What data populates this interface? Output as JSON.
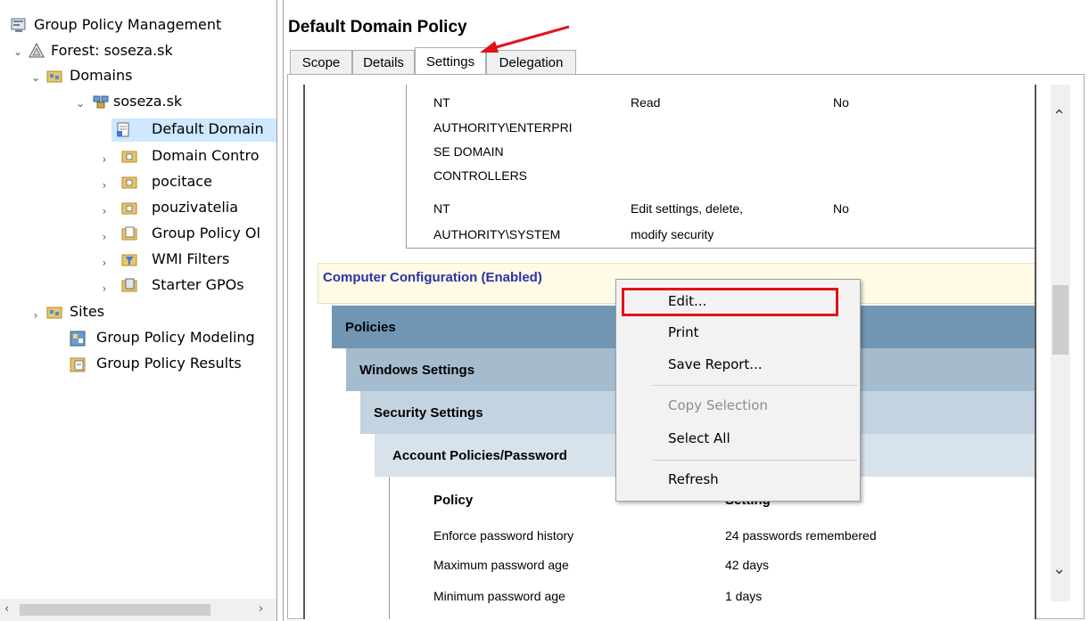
{
  "tree": {
    "root": "Group Policy Management",
    "forest": "Forest: soseza.sk",
    "domains": "Domains",
    "domain": "soseza.sk",
    "items": [
      "Default Domain",
      "Domain Contro",
      "pocitace",
      "pouzivatelia",
      "Group Policy Ol",
      "WMI Filters",
      "Starter GPOs"
    ],
    "sites": "Sites",
    "modeling": "Group Policy Modeling",
    "results": "Group Policy Results"
  },
  "header": {
    "title": "Default Domain Policy",
    "tabs": [
      "Scope",
      "Details",
      "Settings",
      "Delegation"
    ],
    "active_tab": "Settings"
  },
  "report": {
    "delegation_rows": [
      {
        "name_lines": [
          "NT",
          "AUTHORITY\\ENTERPRI",
          "SE DOMAIN",
          "CONTROLLERS"
        ],
        "permission": "Read",
        "inherited": "No"
      },
      {
        "name_lines": [
          "NT",
          "AUTHORITY\\SYSTEM"
        ],
        "permission_lines": [
          "Edit settings, delete,",
          "modify security"
        ],
        "inherited": "No"
      }
    ],
    "computer_config": "Computer Configuration (Enabled)",
    "bands": [
      "Policies",
      "Windows Settings",
      "Security Settings",
      "Account Policies/Password"
    ],
    "table": {
      "col_policy": "Policy",
      "col_setting": "Setting",
      "rows": [
        {
          "policy": "Enforce password history",
          "setting": "24 passwords remembered"
        },
        {
          "policy": "Maximum password age",
          "setting": "42 days"
        },
        {
          "policy": "Minimum password age",
          "setting": "1 days"
        }
      ]
    }
  },
  "context_menu": {
    "items": [
      "Edit...",
      "Print",
      "Save Report...",
      "Copy Selection",
      "Select All",
      "Refresh"
    ]
  },
  "colors": {
    "highlight_red": "#e0131a",
    "computer_config_bg": "#fffbe6",
    "computer_config_text": "#2b32a8",
    "band_policies": "#7096b4",
    "band_windows": "#a5bccf",
    "band_security": "#c4d3e0",
    "band_account": "#d8e2eb"
  }
}
